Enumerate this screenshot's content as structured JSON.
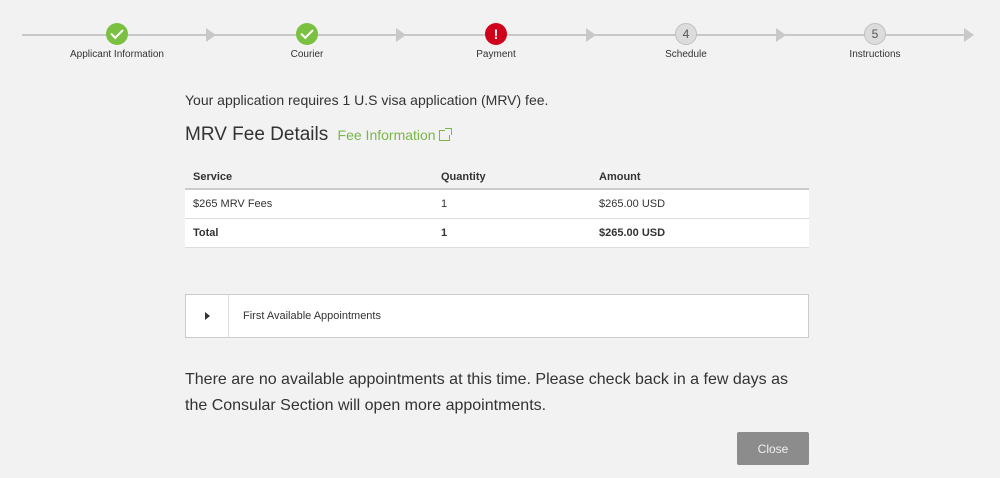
{
  "stepper": {
    "steps": [
      {
        "label": "Applicant Information",
        "status": "done",
        "number": ""
      },
      {
        "label": "Courier",
        "status": "done",
        "number": ""
      },
      {
        "label": "Payment",
        "status": "error",
        "number": "!"
      },
      {
        "label": "Schedule",
        "status": "todo",
        "number": "4"
      },
      {
        "label": "Instructions",
        "status": "todo",
        "number": "5"
      }
    ]
  },
  "summary": {
    "requires_text": "Your application requires 1 U.S visa application (MRV) fee."
  },
  "fee_details": {
    "title": "MRV Fee Details",
    "link_label": "Fee Information"
  },
  "fee_table": {
    "headers": {
      "service": "Service",
      "quantity": "Quantity",
      "amount": "Amount"
    },
    "row": {
      "service": "$265 MRV Fees",
      "quantity": "1",
      "amount": "$265.00 USD"
    },
    "total": {
      "service": "Total",
      "quantity": "1",
      "amount": "$265.00 USD"
    }
  },
  "appointments": {
    "panel_label": "First Available Appointments",
    "notice": "There are no available appointments at this time. Please check back in a few days as the Consular Section will open more appointments."
  },
  "actions": {
    "close_label": "Close"
  },
  "colors": {
    "done": "#7ac142",
    "error": "#d0021b",
    "link": "#7ab648",
    "button": "#8c8c8c"
  }
}
